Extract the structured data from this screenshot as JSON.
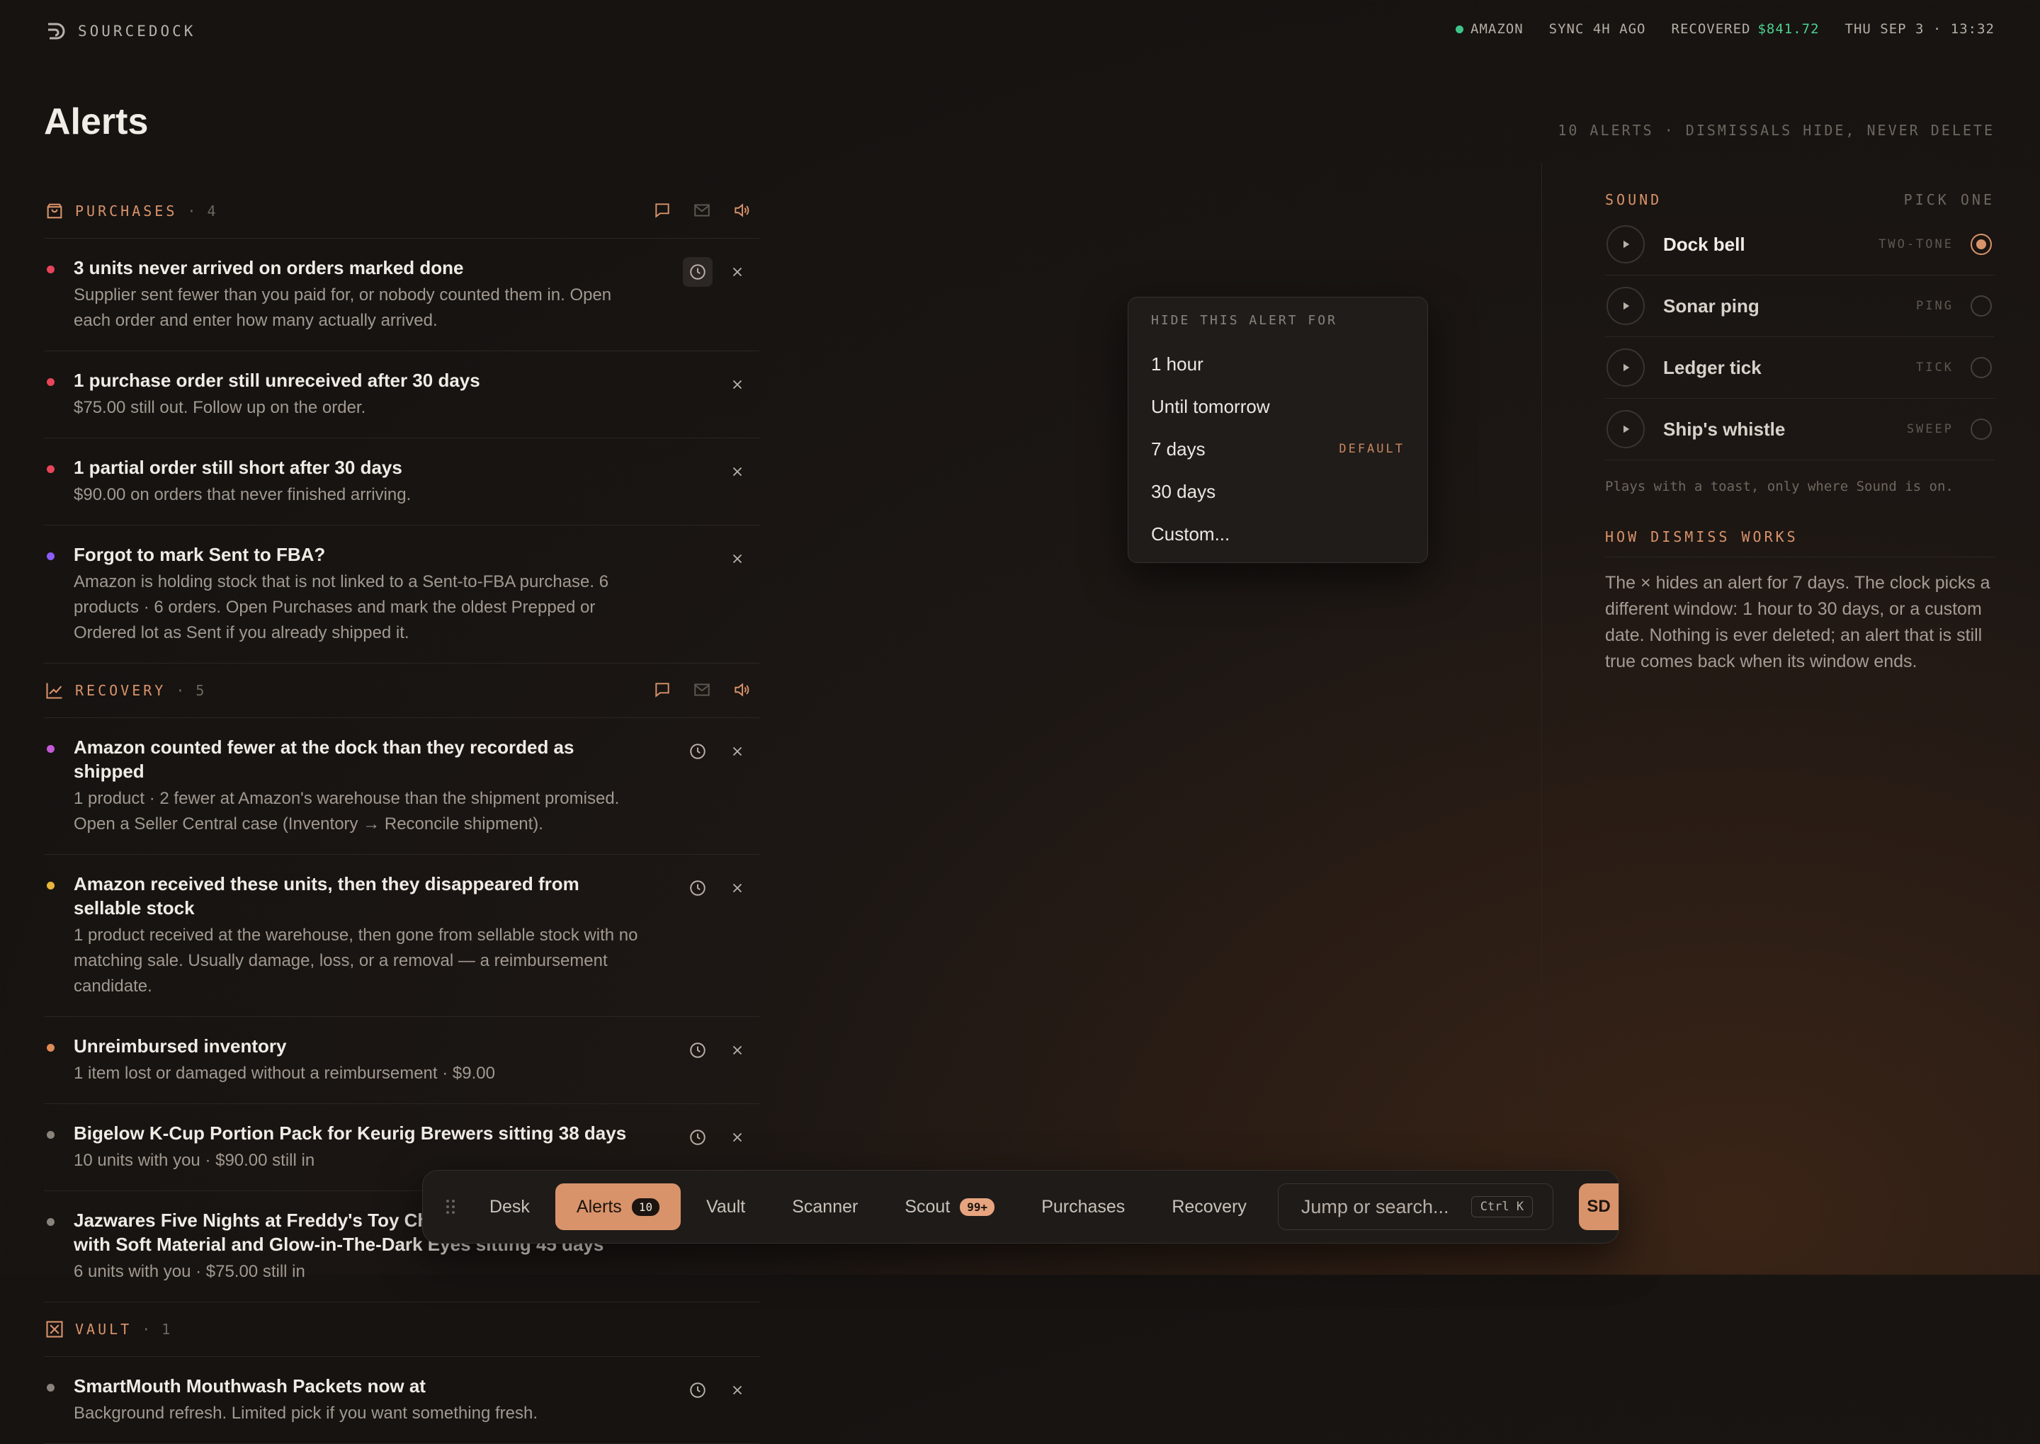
{
  "app": {
    "brand": "SOURCEDOCK"
  },
  "status": {
    "channel": "AMAZON",
    "sync": "SYNC 4H AGO",
    "recovered_label": "RECOVERED",
    "recovered_value": "$841.72",
    "clock": "THU SEP 3 · 13:32"
  },
  "page": {
    "title": "Alerts",
    "meta": "10 ALERTS · DISMISSALS HIDE, NEVER DELETE"
  },
  "sections": [
    {
      "title": "PURCHASES",
      "count": "· 4",
      "alerts": [
        {
          "title": "3 units never arrived on orders marked done",
          "desc": "Supplier sent fewer than you paid for, or nobody counted them in. Open each order and enter how many actually arrived.",
          "color": "#e8455a"
        },
        {
          "title": "1 purchase order still unreceived after 30 days",
          "desc": "$75.00 still out. Follow up on the order.",
          "color": "#e8455a"
        },
        {
          "title": "1 partial order still short after 30 days",
          "desc": "$90.00 on orders that never finished arriving.",
          "color": "#e8455a"
        },
        {
          "title": "Forgot to mark Sent to FBA?",
          "desc": "Amazon is holding stock that is not linked to a Sent-to-FBA purchase. 6 products · 6 orders. Open Purchases and mark the oldest Prepped or Ordered lot as Sent if you already shipped it.",
          "color": "#8b5cf6"
        }
      ]
    },
    {
      "title": "RECOVERY",
      "count": "· 5",
      "alerts": [
        {
          "title": "Amazon counted fewer at the dock than they recorded as shipped",
          "desc": "1 product · 2 fewer at Amazon's warehouse than the shipment promised. Open a Seller Central case (Inventory → Reconcile shipment).",
          "color": "#c55ad8"
        },
        {
          "title": "Amazon received these units, then they disappeared from sellable stock",
          "desc": "1 product received at the warehouse, then gone from sellable stock with no matching sale. Usually damage, loss, or a removal — a reimbursement candidate.",
          "color": "#e8b53a"
        },
        {
          "title": "Unreimbursed inventory",
          "desc": "1 item lost or damaged without a reimbursement · $9.00",
          "color": "#e08a55"
        },
        {
          "title": "Bigelow K-Cup Portion Pack for Keurig Brewers sitting 38 days",
          "desc": "10 units with you · $90.00 still in",
          "color": "#8a837c"
        },
        {
          "title": "Jazwares Five Nights at Freddy's Toy Chica Plush - 8-Inch Stuffie with Soft Material and Glow-in-The-Dark Eyes sitting 45 days",
          "desc": "6 units with you · $75.00 still in",
          "color": "#8a837c"
        }
      ]
    },
    {
      "title": "VAULT",
      "count": "· 1",
      "alerts": [
        {
          "title": "SmartMouth Mouthwash Packets now at",
          "desc": "Background refresh. Limited pick if you want something fresh.",
          "color": "#8a837c"
        }
      ]
    }
  ],
  "popover": {
    "heading": "HIDE THIS ALERT FOR",
    "options": [
      "1 hour",
      "Until tomorrow",
      "7 days",
      "30 days",
      "Custom..."
    ],
    "default_tag": "DEFAULT"
  },
  "sound": {
    "heading": "SOUND",
    "hint": "PICK ONE",
    "options": [
      {
        "name": "Dock bell",
        "tag": "TWO-TONE",
        "selected": true
      },
      {
        "name": "Sonar ping",
        "tag": "PING",
        "selected": false
      },
      {
        "name": "Ledger tick",
        "tag": "TICK",
        "selected": false
      },
      {
        "name": "Ship's whistle",
        "tag": "SWEEP",
        "selected": false
      }
    ],
    "note": "Plays with a toast, only where Sound is on."
  },
  "dismiss": {
    "heading": "HOW DISMISS WORKS",
    "body": "The × hides an alert for 7 days. The clock picks a different window: 1 hour to 30 days, or a custom date. Nothing is ever deleted; an alert that is still true comes back when its window ends."
  },
  "dock": {
    "items": [
      {
        "label": "Desk"
      },
      {
        "label": "Alerts",
        "badge": "10"
      },
      {
        "label": "Vault"
      },
      {
        "label": "Scanner"
      },
      {
        "label": "Scout",
        "badge": "99+"
      },
      {
        "label": "Purchases"
      },
      {
        "label": "Recovery"
      }
    ],
    "search_placeholder": "Jump or search...",
    "shortcut": "Ctrl K",
    "avatar": "SD"
  },
  "colors": {
    "accent": "#d9936a",
    "positive": "#4fd18f"
  },
  "icons": [
    "logo-icon",
    "bag-icon",
    "chart-icon",
    "vault-icon",
    "chat-icon",
    "mail-icon",
    "speaker-icon",
    "clock-icon",
    "close-icon",
    "play-icon",
    "grip-icon"
  ]
}
